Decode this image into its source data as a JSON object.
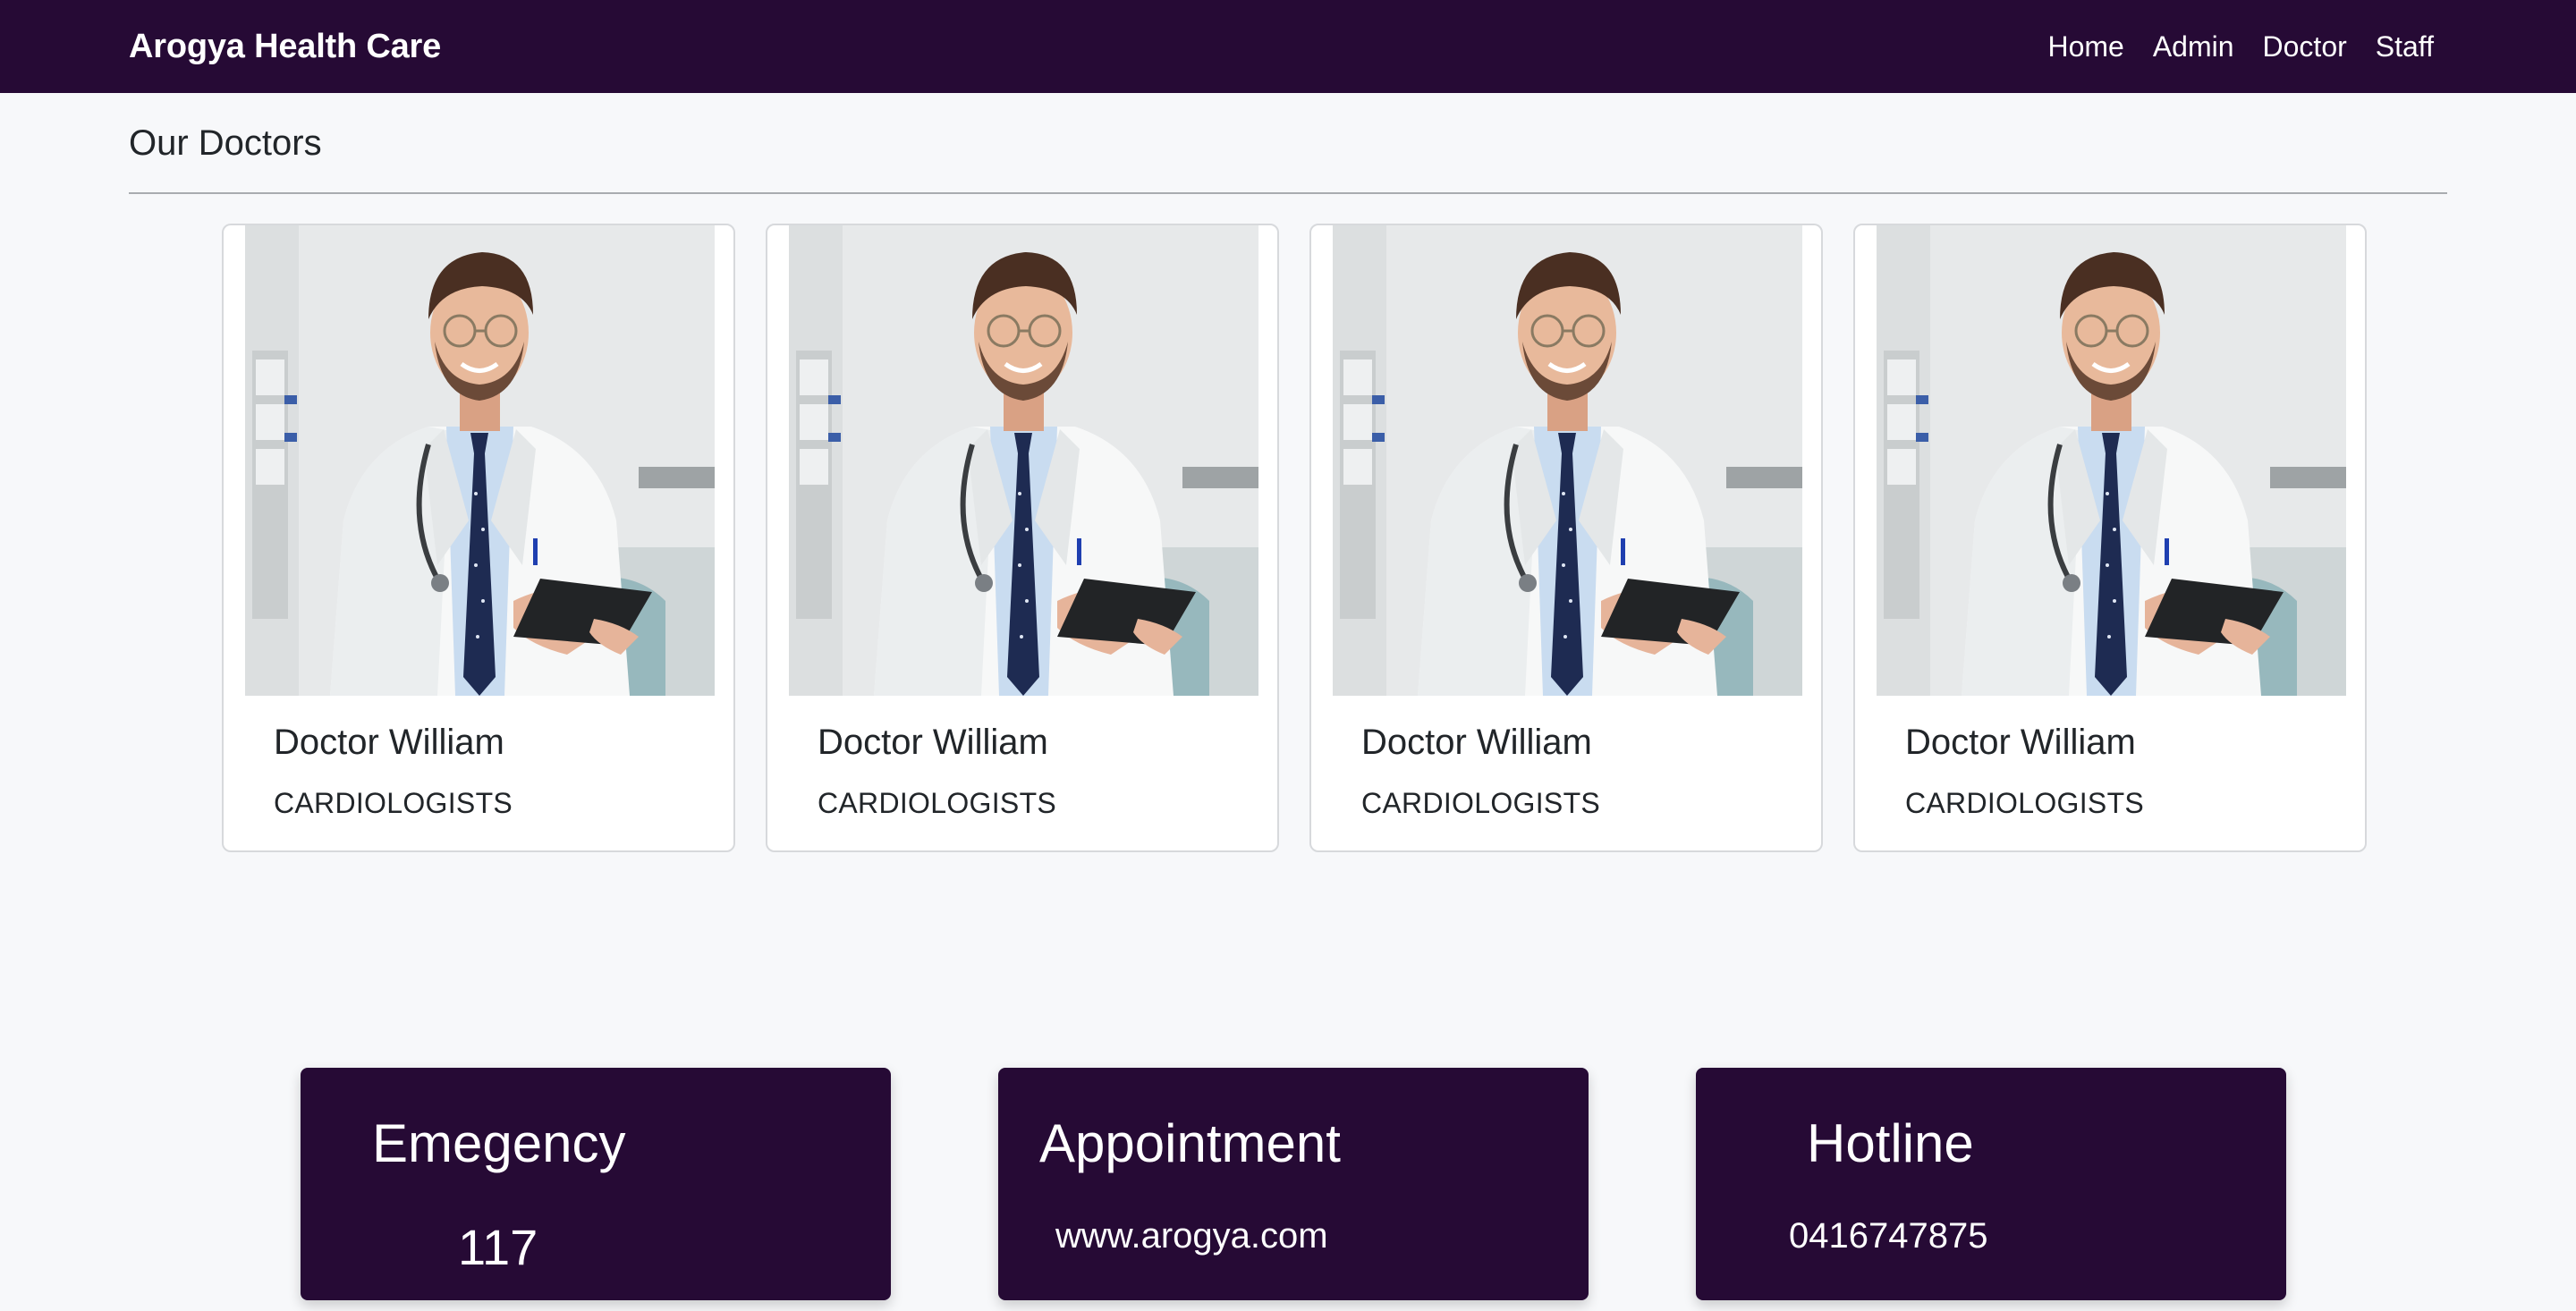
{
  "navbar": {
    "brand": "Arogya Health Care",
    "links": [
      "Home",
      "Admin",
      "Doctor",
      "Staff"
    ]
  },
  "section": {
    "title": "Our Doctors"
  },
  "doctors": [
    {
      "name": "Doctor William",
      "specialty": "CARDIOLOGISTS"
    },
    {
      "name": "Doctor William",
      "specialty": "CARDIOLOGISTS"
    },
    {
      "name": "Doctor William",
      "specialty": "CARDIOLOGISTS"
    },
    {
      "name": "Doctor William",
      "specialty": "CARDIOLOGISTS"
    }
  ],
  "info_boxes": {
    "emergency": {
      "title": "Emegency",
      "value": "117"
    },
    "appointment": {
      "title": "Appointment",
      "value": "www.arogya.com"
    },
    "hotline": {
      "title": "Hotline",
      "value": "0416747875"
    }
  },
  "colors": {
    "primary": "#260a35",
    "background": "#f7f8fa",
    "card_border": "#d7d9dc",
    "text": "#212529"
  }
}
